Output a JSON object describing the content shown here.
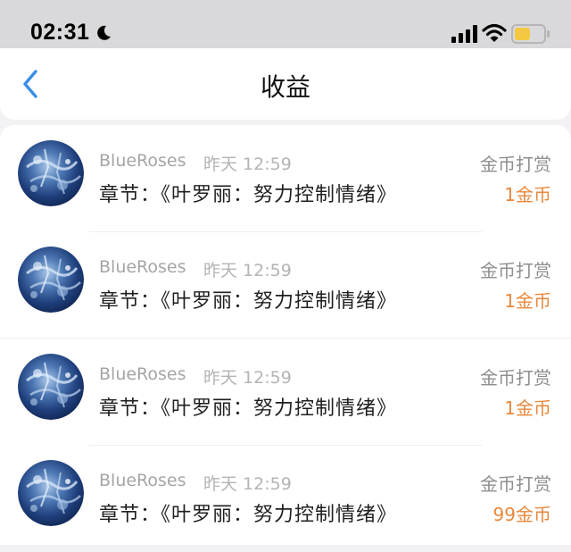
{
  "status_bar": {
    "time": "02:31",
    "icons": [
      "moon-icon",
      "signal-icon",
      "wifi-icon",
      "battery-icon"
    ],
    "battery_color": "#f5c842"
  },
  "nav": {
    "title": "收益",
    "back_icon": "chevron-left-icon",
    "accent": "#3a8ee6"
  },
  "records": [
    {
      "user": "BlueRoses",
      "time": "昨天 12:59",
      "chapter": "章节：《叶罗丽：努力控制情绪》",
      "type": "金币打赏",
      "amount": "1金币"
    },
    {
      "user": "BlueRoses",
      "time": "昨天 12:59",
      "chapter": "章节：《叶罗丽：努力控制情绪》",
      "type": "金币打赏",
      "amount": "1金币"
    },
    {
      "user": "BlueRoses",
      "time": "昨天 12:59",
      "chapter": "章节：《叶罗丽：努力控制情绪》",
      "type": "金币打赏",
      "amount": "1金币"
    },
    {
      "user": "BlueRoses",
      "time": "昨天 12:59",
      "chapter": "章节：《叶罗丽：努力控制情绪》",
      "type": "金币打赏",
      "amount": "99金币"
    }
  ],
  "amount_color": "#e8883b"
}
